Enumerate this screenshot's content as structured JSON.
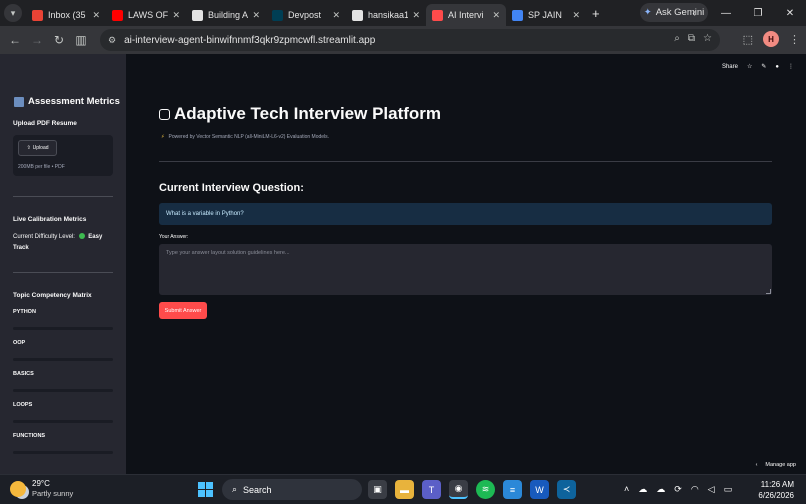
{
  "browser": {
    "tabs": [
      {
        "title": "Inbox (35",
        "favicon": "gmail-icon",
        "color": "#ea4335"
      },
      {
        "title": "LAWS OF",
        "favicon": "youtube-icon",
        "color": "#ff0000"
      },
      {
        "title": "Building A",
        "favicon": "openai-icon",
        "color": "#e3e3e3"
      },
      {
        "title": "Devpost",
        "favicon": "devpost-icon",
        "color": "#003e54"
      },
      {
        "title": "hansikaa1",
        "favicon": "github-icon",
        "color": "#e3e3e3"
      },
      {
        "title": "AI Intervi",
        "favicon": "streamlit-icon",
        "color": "#ff4b4b"
      },
      {
        "title": "SP JAIN",
        "favicon": "document-icon",
        "color": "#4285f4"
      }
    ],
    "active_tab": 5,
    "new_tab": "+",
    "gemini_label": "Ask Gemini",
    "url": "ai-interview-agent-binwifnnmf3qkr9zpmcwfl.streamlit.app",
    "profile_initial": "H"
  },
  "sidebar": {
    "title": "Assessment Metrics",
    "upload_label": "Upload PDF Resume",
    "upload_button": "Upload",
    "upload_hint": "200MB per file • PDF",
    "calibration_label": "Live Calibration Metrics",
    "difficulty_prefix": "Current Difficulty Level:",
    "difficulty_value": "Easy",
    "difficulty_suffix": "Track",
    "matrix_label": "Topic Competency Matrix",
    "topics": [
      {
        "name": "PYTHON",
        "progress": 0
      },
      {
        "name": "OOP",
        "progress": 0
      },
      {
        "name": "BASICS",
        "progress": 0
      },
      {
        "name": "LOOPS",
        "progress": 0
      },
      {
        "name": "FUNCTIONS",
        "progress": 0
      }
    ]
  },
  "main": {
    "toolbar": {
      "share": "Share"
    },
    "title": "Adaptive Tech Interview Platform",
    "powered_by": "Powered by Vector Semantic NLP (all-MiniLM-L6-v2) Evaluation Models.",
    "question_heading": "Current Interview Question:",
    "question": "What is a variable in Python?",
    "answer_label": "Your Answer:",
    "answer_placeholder": "Type your answer layout solution guidelines here...",
    "submit_label": "Submit Answer",
    "manage_app": "Manage app"
  },
  "taskbar": {
    "temperature": "29°C",
    "weather": "Partly sunny",
    "search_label": "Search",
    "time": "11:26 AM",
    "date": "6/26/2026"
  },
  "colors": {
    "accent": "#ff4b4b",
    "sidebar_bg": "#262730",
    "main_bg": "#0e1117",
    "info_bg": "#172d43"
  }
}
